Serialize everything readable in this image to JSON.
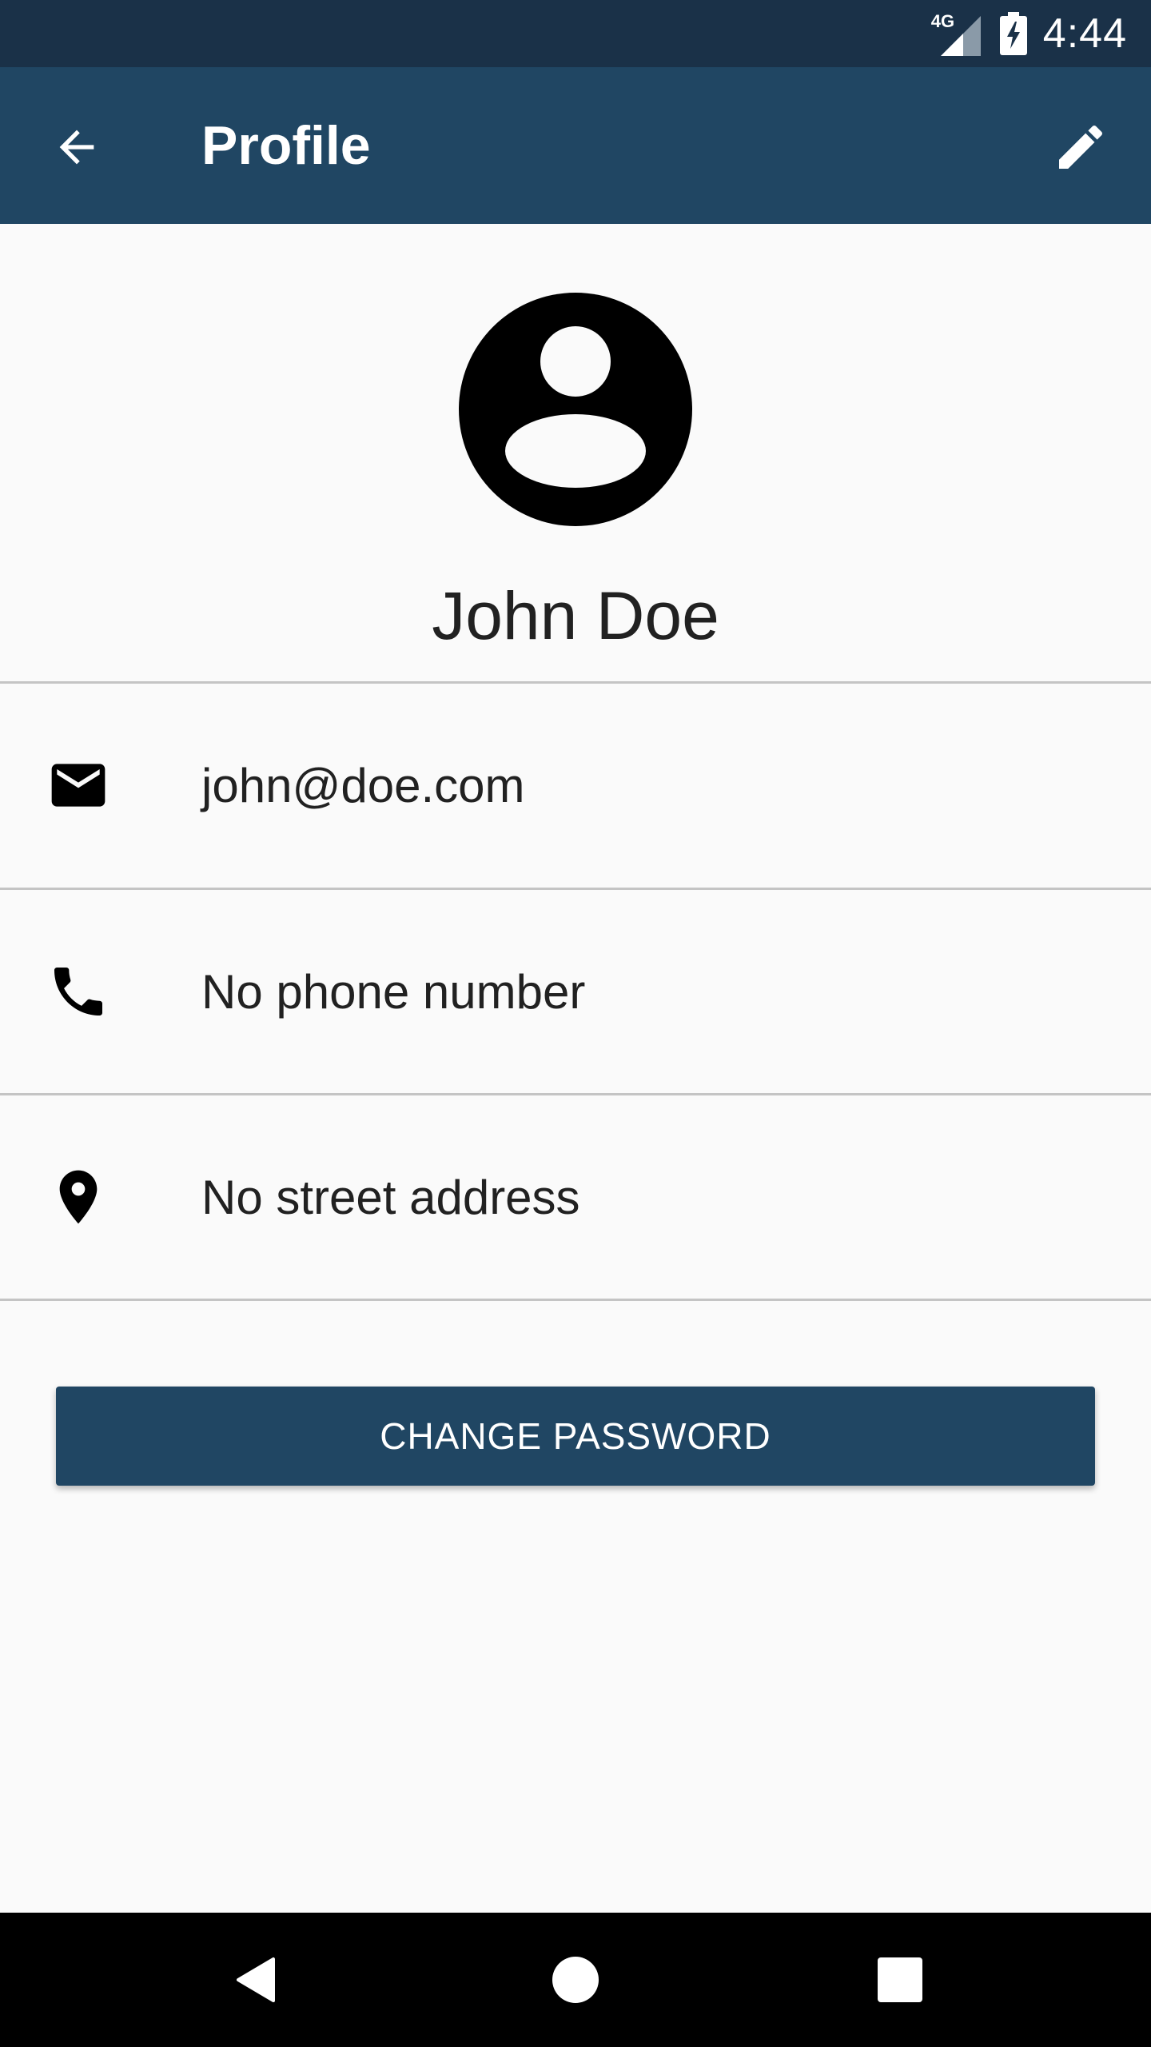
{
  "status_bar": {
    "network_label": "4G",
    "time": "4:44",
    "icons": [
      "signal-icon",
      "battery-charging-icon"
    ]
  },
  "app_bar": {
    "title": "Profile",
    "back_icon": "arrow-back-icon",
    "edit_icon": "pencil-icon"
  },
  "profile": {
    "avatar_icon": "account-circle-icon",
    "name": "John Doe"
  },
  "details": [
    {
      "icon": "mail-icon",
      "value": "john@doe.com"
    },
    {
      "icon": "phone-icon",
      "value": "No phone number"
    },
    {
      "icon": "location-pin-icon",
      "value": "No street address"
    }
  ],
  "actions": {
    "change_password_label": "CHANGE PASSWORD"
  },
  "nav_bar": {
    "icons": [
      "nav-back-icon",
      "nav-home-icon",
      "nav-recents-icon"
    ]
  },
  "colors": {
    "status_bar": "#1a3148",
    "primary": "#204663",
    "background": "#fafafa",
    "divider": "#c4c4c4",
    "text": "#212121"
  }
}
